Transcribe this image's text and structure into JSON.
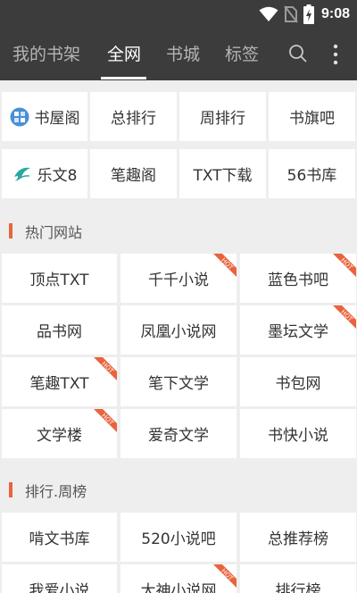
{
  "status": {
    "time": "9:08"
  },
  "tabs": [
    "我的书架",
    "全网",
    "书城",
    "标签"
  ],
  "quick_links": [
    {
      "label": "书屋阁",
      "icon": "book-house-logo-icon"
    },
    {
      "label": "总排行"
    },
    {
      "label": "周排行"
    },
    {
      "label": "书旗吧"
    },
    {
      "label": "乐文8",
      "icon": "lewen-bird-logo-icon"
    },
    {
      "label": "笔趣阁"
    },
    {
      "label": "TXT下载"
    },
    {
      "label": "56书库"
    }
  ],
  "sections": [
    {
      "title": "热门网站",
      "items": [
        {
          "label": "顶点TXT",
          "hot": false
        },
        {
          "label": "千千小说",
          "hot": true
        },
        {
          "label": "蓝色书吧",
          "hot": true
        },
        {
          "label": "品书网",
          "hot": false
        },
        {
          "label": "凤凰小说网",
          "hot": false
        },
        {
          "label": "墨坛文学",
          "hot": true
        },
        {
          "label": "笔趣TXT",
          "hot": true
        },
        {
          "label": "笔下文学",
          "hot": false
        },
        {
          "label": "书包网",
          "hot": false
        },
        {
          "label": "文学楼",
          "hot": true
        },
        {
          "label": "爱奇文学",
          "hot": false
        },
        {
          "label": "书快小说",
          "hot": false
        }
      ]
    },
    {
      "title": "排行.周榜",
      "items": [
        {
          "label": "啃文书库",
          "hot": false
        },
        {
          "label": "520小说吧",
          "hot": false
        },
        {
          "label": "总推荐榜",
          "hot": false
        },
        {
          "label": "我爱小说",
          "hot": false
        },
        {
          "label": "大神小说网",
          "hot": true
        },
        {
          "label": "排行榜",
          "hot": false
        }
      ]
    }
  ],
  "badge": {
    "text": "HOT",
    "color": "#e8643c"
  },
  "colors": {
    "appbar": "#3c3c3c",
    "accent": "#e8643c",
    "background": "#eeeeee"
  }
}
